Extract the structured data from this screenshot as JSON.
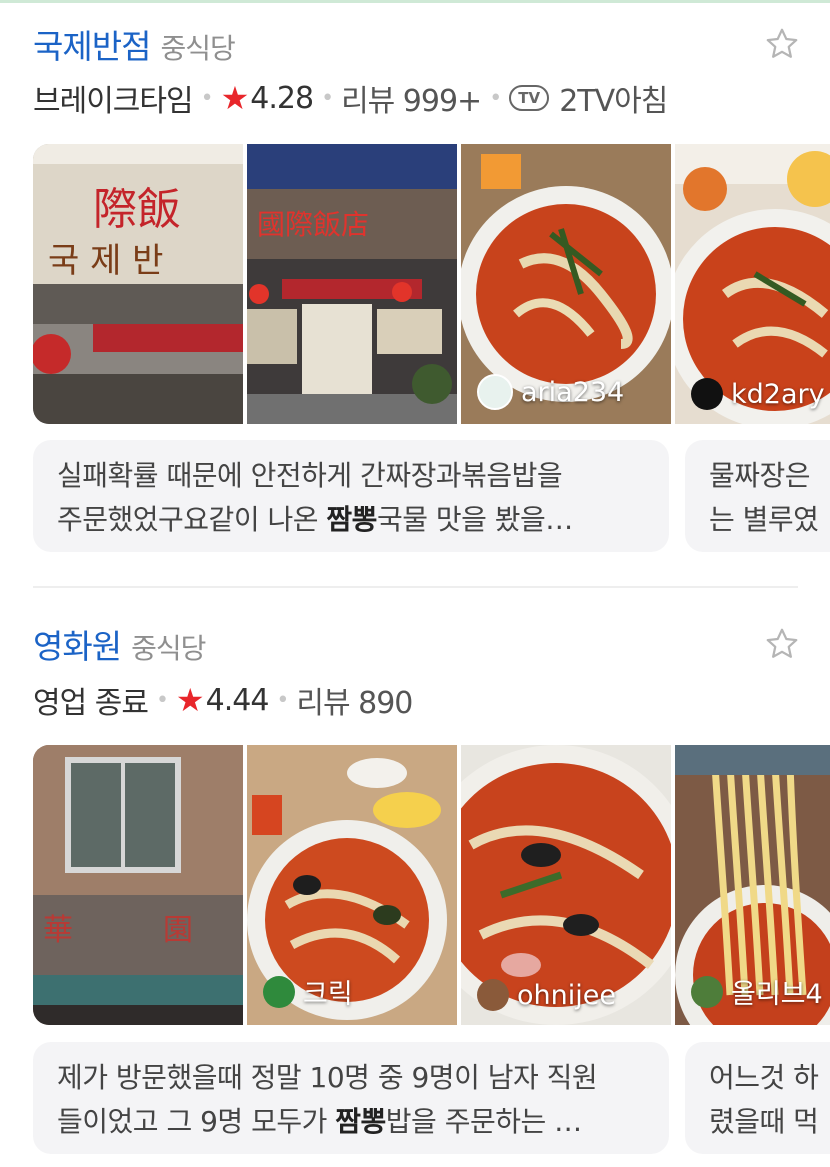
{
  "restaurants": [
    {
      "name": "국제반점",
      "category": "중식당",
      "status": "브레이크타임",
      "rating": "4.28",
      "reviews": "리뷰 999+",
      "tv_badge": "TV",
      "tv_show": "2TV아침",
      "photo_credits": [
        "aria234",
        "kd2ary"
      ],
      "review_cards": [
        {
          "line1": "실패확률 때문에 안전하게 간짜장과볶음밥을",
          "line2_pre": "주문했었구요같이 나온 ",
          "line2_bold": "짬뽕",
          "line2_post": "국물 맛을 봤을…"
        },
        {
          "line1": "물짜장은",
          "line2": "는 별루였"
        }
      ]
    },
    {
      "name": "영화원",
      "category": "중식당",
      "status": "영업 종료",
      "rating": "4.44",
      "reviews": "리뷰 890",
      "photo_credits": [
        "크릭",
        "ohnijee",
        "올리브4"
      ],
      "review_cards": [
        {
          "line1": "제가 방문했을때 정말 10명 중 9명이 남자 직원",
          "line2_pre": "들이었고 그 9명 모두가 ",
          "line2_bold": "짬뽕",
          "line2_post": "밥을 주문하는 …"
        },
        {
          "line1": "어느것 하",
          "line2": "렸을때 먹"
        }
      ]
    }
  ],
  "colors": {
    "name": "#1b63c6",
    "rating_star": "#e8262b",
    "review_bg": "#f4f4f6"
  },
  "icons": {
    "favorite": "star-outline-icon",
    "rating": "star-filled-icon",
    "tv": "tv-icon"
  }
}
